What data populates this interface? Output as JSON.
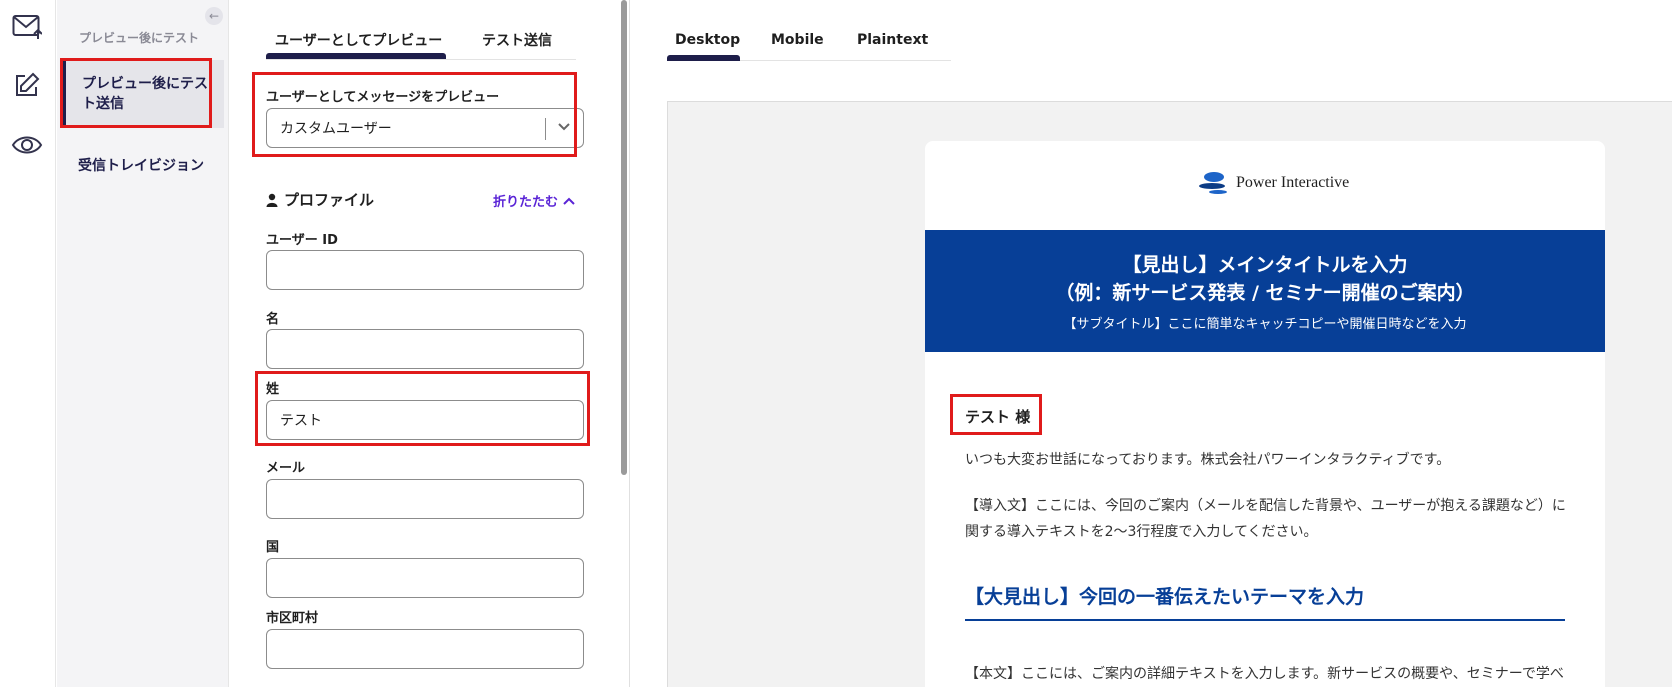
{
  "sidebar": {
    "heading": "プレビュー後にテスト",
    "items": [
      {
        "label": "プレビュー後にテスト送信",
        "active": true
      },
      {
        "label": "受信トレイビジョン",
        "active": false
      }
    ],
    "rail_icons": [
      "mail-send-icon",
      "edit-icon",
      "eye-icon"
    ]
  },
  "panel": {
    "tabs": [
      "ユーザーとしてプレビュー",
      "テスト送信"
    ],
    "preview_label": "ユーザーとしてメッセージをプレビュー",
    "preview_select_value": "カスタムユーザー",
    "profile_title": "プロファイル",
    "collapse_label": "折りたたむ",
    "fields": [
      {
        "label": "ユーザー ID",
        "value": ""
      },
      {
        "label": "名",
        "value": ""
      },
      {
        "label": "姓",
        "value": "テスト"
      },
      {
        "label": "メール",
        "value": ""
      },
      {
        "label": "国",
        "value": ""
      },
      {
        "label": "市区町村",
        "value": ""
      }
    ]
  },
  "preview": {
    "tabs": [
      "Desktop",
      "Mobile",
      "Plaintext"
    ],
    "email": {
      "logo_text": "Power Interactive",
      "hero_line1": "【見出し】メインタイトルを入力",
      "hero_line2": "（例：新サービス発表 / セミナー開催のご案内）",
      "hero_sub": "【サブタイトル】ここに簡単なキャッチコピーや開催日時などを入力",
      "greeting": "テスト 様",
      "para1": "いつも大変お世話になっております。株式会社パワーインタラクティブです。",
      "para2": "【導入文】ここには、今回のご案内（メールを配信した背景や、ユーザーが抱える課題など）に関する導入テキストを2～3行程度で入力してください。",
      "h2": "【大見出し】今回の一番伝えたいテーマを入力",
      "para3": "【本文】ここには、ご案内の詳細テキストを入力します。新サービスの概要や、セミナーで学べることの背景などを詳しく記載してください。適宜改行を入れると読みやすくなり"
    }
  },
  "colors": {
    "brand_navy": "#1e1e4a",
    "hero_blue": "#073f97",
    "highlight_red": "#e01b1b",
    "link_purple": "#5a24d6"
  }
}
